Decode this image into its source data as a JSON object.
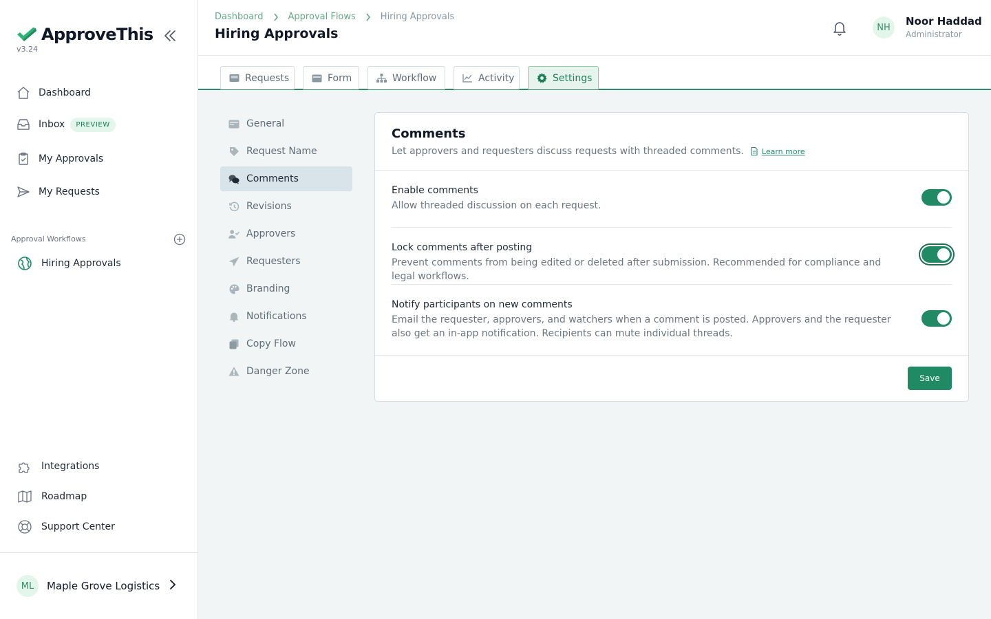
{
  "app": {
    "name": "ApproveThis",
    "version": "v3.24"
  },
  "sidebar": {
    "nav": [
      {
        "label": "Dashboard"
      },
      {
        "label": "Inbox",
        "badge": "PREVIEW"
      },
      {
        "label": "My Approvals"
      },
      {
        "label": "My Requests"
      }
    ],
    "section_label": "Approval Workflows",
    "workflows": [
      {
        "label": "Hiring Approvals"
      }
    ],
    "bottom": [
      {
        "label": "Integrations"
      },
      {
        "label": "Roadmap"
      },
      {
        "label": "Support Center"
      }
    ],
    "org": {
      "initials": "ML",
      "name": "Maple Grove Logistics"
    }
  },
  "header": {
    "breadcrumbs": [
      "Dashboard",
      "Approval Flows",
      "Hiring Approvals"
    ],
    "title": "Hiring Approvals",
    "user": {
      "initials": "NH",
      "name": "Noor Haddad",
      "role": "Administrator"
    }
  },
  "tabs": [
    {
      "label": "Requests"
    },
    {
      "label": "Form"
    },
    {
      "label": "Workflow"
    },
    {
      "label": "Activity"
    },
    {
      "label": "Settings",
      "active": true
    }
  ],
  "settings_nav": [
    {
      "label": "General"
    },
    {
      "label": "Request Name"
    },
    {
      "label": "Comments",
      "active": true
    },
    {
      "label": "Revisions"
    },
    {
      "label": "Approvers"
    },
    {
      "label": "Requesters"
    },
    {
      "label": "Branding"
    },
    {
      "label": "Notifications"
    },
    {
      "label": "Copy Flow"
    },
    {
      "label": "Danger Zone"
    }
  ],
  "comments_card": {
    "title": "Comments",
    "description": "Let approvers and requesters discuss requests with threaded comments.",
    "learn_more": "Learn more",
    "settings": [
      {
        "title": "Enable comments",
        "description": "Allow threaded discussion on each request.",
        "enabled": true
      },
      {
        "title": "Lock comments after posting",
        "description": "Prevent comments from being edited or deleted after submission. Recommended for compliance and legal workflows.",
        "enabled": true
      },
      {
        "title": "Notify participants on new comments",
        "description": "Email the requester, approvers, and watchers when a comment is posted. Approvers and the requester also get an in-app notification. Recipients can mute individual threads.",
        "enabled": true
      }
    ],
    "save_label": "Save"
  },
  "colors": {
    "accent": "#1f8a63",
    "accent_light": "#e3f6ec",
    "link": "#2e8c69"
  }
}
